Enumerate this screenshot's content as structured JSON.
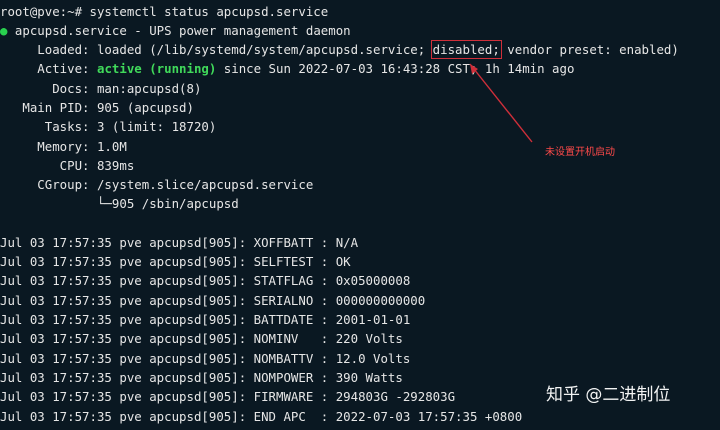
{
  "terminal": {
    "prompt_line": "root@pve:~# systemctl status apcupsd.service",
    "header": {
      "dot": "●",
      "text": " apcupsd.service - UPS power management daemon"
    },
    "loaded": {
      "prefix": "     Loaded: loaded (/lib/systemd/system/apcupsd.service; ",
      "highlight": "disabled;",
      "suffix": " vendor preset: enabled)"
    },
    "active": {
      "prefix": "     Active: ",
      "state": "active (running)",
      "suffix": " since Sun 2022-07-03 16:43:28 CST; 1h 14min ago"
    },
    "details": [
      "       Docs: man:apcupsd(8)",
      "   Main PID: 905 (apcupsd)",
      "      Tasks: 3 (limit: 18720)",
      "     Memory: 1.0M",
      "        CPU: 839ms",
      "     CGroup: /system.slice/apcupsd.service",
      "             └─905 /sbin/apcupsd"
    ],
    "logs": [
      "Jul 03 17:57:35 pve apcupsd[905]: XOFFBATT : N/A",
      "Jul 03 17:57:35 pve apcupsd[905]: SELFTEST : OK",
      "Jul 03 17:57:35 pve apcupsd[905]: STATFLAG : 0x05000008",
      "Jul 03 17:57:35 pve apcupsd[905]: SERIALNO : 000000000000",
      "Jul 03 17:57:35 pve apcupsd[905]: BATTDATE : 2001-01-01",
      "Jul 03 17:57:35 pve apcupsd[905]: NOMINV   : 220 Volts",
      "Jul 03 17:57:35 pve apcupsd[905]: NOMBATTV : 12.0 Volts",
      "Jul 03 17:57:35 pve apcupsd[905]: NOMPOWER : 390 Watts",
      "Jul 03 17:57:35 pve apcupsd[905]: FIRMWARE : 294803G -292803G",
      "Jul 03 17:57:35 pve apcupsd[905]: END APC  : 2022-07-03 17:57:35 +0800"
    ]
  },
  "annotation": {
    "text": "未设置开机启动",
    "color": "#ff4a4a"
  },
  "watermark": {
    "text": "知乎 @二进制位"
  },
  "colors": {
    "background": "#0a1822",
    "text": "#e6e6e6",
    "active_green": "#40d95a",
    "annotation_red": "#cf2f3a"
  }
}
